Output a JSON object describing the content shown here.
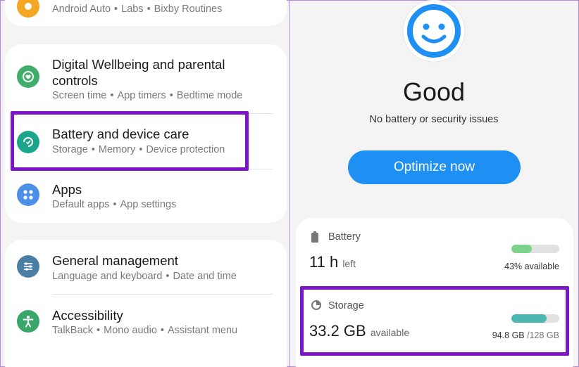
{
  "settings": {
    "top_partial_subtitle": [
      "Android Auto",
      "Labs",
      "Bixby Routines"
    ],
    "items": [
      {
        "title": "Digital Wellbeing and parental controls",
        "subtitle": [
          "Screen time",
          "App timers",
          "Bedtime mode"
        ],
        "icon": "digital-wellbeing-icon",
        "color": "#3fae6a"
      },
      {
        "title": "Battery and device care",
        "subtitle": [
          "Storage",
          "Memory",
          "Device protection"
        ],
        "icon": "device-care-icon",
        "color": "#1ba58b"
      },
      {
        "title": "Apps",
        "subtitle": [
          "Default apps",
          "App settings"
        ],
        "icon": "apps-grid-icon",
        "color": "#4b8fe8"
      },
      {
        "title": "General management",
        "subtitle": [
          "Language and keyboard",
          "Date and time"
        ],
        "icon": "sliders-icon",
        "color": "#4b7fa5"
      },
      {
        "title": "Accessibility",
        "subtitle": [
          "TalkBack",
          "Mono audio",
          "Assistant menu"
        ],
        "icon": "accessibility-icon",
        "color": "#3aa66a"
      }
    ]
  },
  "device_care": {
    "status": "Good",
    "status_message": "No battery or security issues",
    "optimize_label": "Optimize now",
    "battery": {
      "label": "Battery",
      "value": "11 h",
      "unit": "left",
      "right_text": "43% available",
      "fraction": 0.43,
      "color": "#7ed38c"
    },
    "storage": {
      "label": "Storage",
      "value": "33.2 GB",
      "unit": "available",
      "used": "94.8 GB",
      "total": "/128 GB",
      "fraction": 0.74,
      "color": "#4cb6b2"
    }
  },
  "colors": {
    "highlight": "#7a16c7",
    "accent_blue": "#1e8ff3",
    "smiley_blue": "#1e8ff3"
  }
}
